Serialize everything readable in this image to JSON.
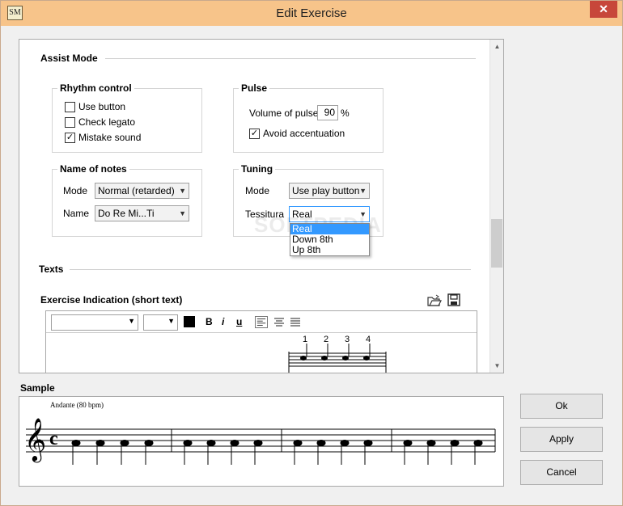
{
  "window": {
    "title": "Edit Exercise",
    "app_icon_text": "SM",
    "close_glyph": "✕"
  },
  "assist_mode": {
    "heading": "Assist Mode",
    "rhythm_control": {
      "title": "Rhythm control",
      "options": [
        {
          "label": "Use button",
          "checked": false
        },
        {
          "label": "Check legato",
          "checked": false
        },
        {
          "label": "Mistake sound",
          "checked": true
        }
      ]
    },
    "pulse": {
      "title": "Pulse",
      "volume_label": "Volume of pulse",
      "volume_value": "90",
      "volume_unit": "%",
      "avoid_label": "Avoid accentuation",
      "avoid_checked": true
    },
    "name_of_notes": {
      "title": "Name of notes",
      "mode_label": "Mode",
      "mode_value": "Normal (retarded)",
      "name_label": "Name",
      "name_value": "Do Re Mi...Ti"
    },
    "tuning": {
      "title": "Tuning",
      "mode_label": "Mode",
      "mode_value": "Use play button",
      "tessitura_label": "Tessitura",
      "tessitura_value": "Real",
      "tessitura_options": [
        "Real",
        "Down 8th",
        "Up 8th"
      ]
    }
  },
  "texts": {
    "heading": "Texts",
    "indication_label": "Exercise Indication (short text)",
    "toolbar": {
      "bold": "B",
      "italic": "i",
      "underline": "u"
    },
    "beat_numbers": [
      "1",
      "2",
      "3",
      "4"
    ]
  },
  "sample": {
    "label": "Sample",
    "tempo": "Andante (80 bpm)",
    "time_signature": "c",
    "clef_glyph": "𝄞"
  },
  "buttons": {
    "ok": "Ok",
    "apply": "Apply",
    "cancel": "Cancel"
  },
  "watermark": "SOFTPEDIA",
  "colors": {
    "titlebar": "#f7c48a",
    "close": "#c7473a",
    "selection": "#3399ff"
  }
}
